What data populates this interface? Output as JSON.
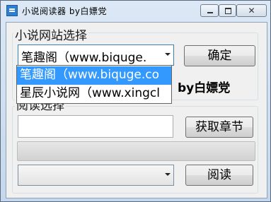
{
  "window": {
    "title": "小说阅读器     by白嫖党",
    "close_glyph": "✕"
  },
  "site_select": {
    "group_label": "小说网站选择",
    "selected": "笔趣阁（www.biquge.",
    "options": [
      "笔趣阁（www.biquge.co",
      "星辰小说网（www.xingcl"
    ],
    "confirm_label": "确定",
    "byline": "by白嫖党"
  },
  "reading": {
    "group_label": "阅读选择",
    "search_value": "",
    "fetch_label": "获取章节",
    "progress": 0,
    "chapter_selected": "",
    "read_label": "阅读"
  },
  "icons": {
    "app": "app-window-icon",
    "minimize": "minimize-icon",
    "maximize": "maximize-icon",
    "close": "close-icon",
    "dropdown": "chevron-down-icon"
  },
  "colors": {
    "selection": "#3399ff",
    "titlebar": "#c9dcef"
  }
}
